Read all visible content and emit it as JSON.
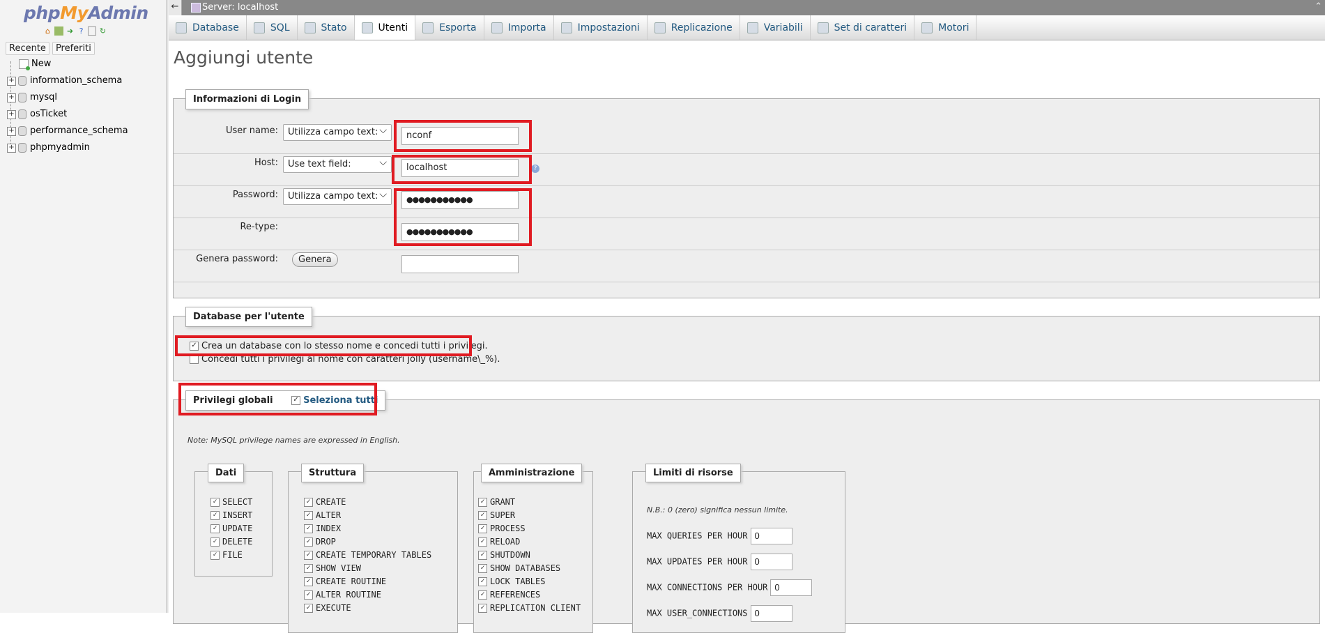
{
  "sidebar": {
    "logo": {
      "php": "php",
      "my": "My",
      "admin": "Admin"
    },
    "icons": [
      "home-icon",
      "sql-window-icon",
      "logout-icon",
      "help-icon",
      "docs-icon",
      "reload-icon"
    ],
    "recent_tab": "Recente",
    "favorites_tab": "Preferiti",
    "new_label": "New",
    "databases": [
      "information_schema",
      "mysql",
      "osTicket",
      "performance_schema",
      "phpmyadmin"
    ]
  },
  "topbar": {
    "back": "←",
    "server": "Server: localhost"
  },
  "tabs": [
    "Database",
    "SQL",
    "Stato",
    "Utenti",
    "Esporta",
    "Importa",
    "Impostazioni",
    "Replicazione",
    "Variabili",
    "Set di caratteri",
    "Motori"
  ],
  "active_tab": "Utenti",
  "page_title": "Aggiungi utente",
  "login": {
    "legend": "Informazioni di Login",
    "username_label": "User name:",
    "username_mode": "Utilizza campo text:",
    "username_value": "nconf",
    "host_label": "Host:",
    "host_mode": "Use text field:",
    "host_value": "localhost",
    "password_label": "Password:",
    "password_mode": "Utilizza campo text:",
    "password_value": "●●●●●●●●●●●",
    "retype_label": "Re-type:",
    "retype_value": "●●●●●●●●●●●",
    "genpass_label": "Genera password:",
    "genpass_button": "Genera"
  },
  "dbuser": {
    "legend": "Database per l'utente",
    "opt1": "Crea un database con lo stesso nome e concedi tutti i privilegi.",
    "opt1_checked": true,
    "opt2": "Concedi tutti i privilegi al nome con caratteri jolly (username\\_%).",
    "opt2_checked": false
  },
  "global": {
    "legend": "Privilegi globali",
    "select_all": "Seleziona tutti",
    "note": "Note: MySQL privilege names are expressed in English.",
    "dati": {
      "title": "Dati",
      "items": [
        "SELECT",
        "INSERT",
        "UPDATE",
        "DELETE",
        "FILE"
      ]
    },
    "struttura": {
      "title": "Struttura",
      "items": [
        "CREATE",
        "ALTER",
        "INDEX",
        "DROP",
        "CREATE TEMPORARY TABLES",
        "SHOW VIEW",
        "CREATE ROUTINE",
        "ALTER ROUTINE",
        "EXECUTE"
      ]
    },
    "amministrazione": {
      "title": "Amministrazione",
      "items": [
        "GRANT",
        "SUPER",
        "PROCESS",
        "RELOAD",
        "SHUTDOWN",
        "SHOW DATABASES",
        "LOCK TABLES",
        "REFERENCES",
        "REPLICATION CLIENT"
      ]
    },
    "limiti": {
      "title": "Limiti di risorse",
      "note": "N.B.: 0 (zero) significa nessun limite.",
      "rows": [
        {
          "label": "MAX QUERIES PER HOUR",
          "value": "0"
        },
        {
          "label": "MAX UPDATES PER HOUR",
          "value": "0"
        },
        {
          "label": "MAX CONNECTIONS PER HOUR",
          "value": "0"
        },
        {
          "label": "MAX USER_CONNECTIONS",
          "value": "0"
        }
      ]
    }
  },
  "colors": {
    "accent": "#235a81",
    "highlight": "#e01b22",
    "logo_orange": "#f29a2e",
    "logo_blue": "#6c78af"
  }
}
